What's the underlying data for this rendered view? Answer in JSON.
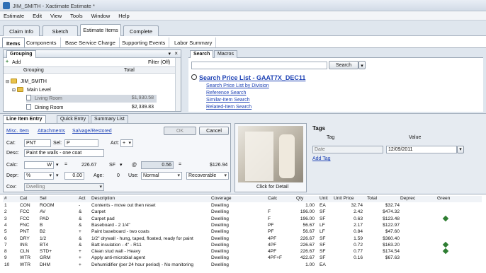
{
  "window": {
    "title": "JIM_SMITH - Xactimate Estimate *"
  },
  "menu": [
    "Estimate",
    "Edit",
    "View",
    "Tools",
    "Window",
    "Help"
  ],
  "main_tabs": [
    "Claim Info",
    "Sketch",
    "Estimate Items",
    "Complete"
  ],
  "sub_tabs": [
    "Items",
    "Components",
    "Base Service Charge",
    "Supporting Events",
    "Labor Summary"
  ],
  "grouping": {
    "title": "Grouping",
    "add_label": "Add",
    "filter_label": "Filter (Off)",
    "col_grouping": "Grouping",
    "col_total": "Total",
    "tree": [
      {
        "label": "JIM_SMITH",
        "total": ""
      },
      {
        "label": "Main Level",
        "total": ""
      },
      {
        "label": "Living Room",
        "total": "$1,930.58"
      },
      {
        "label": "Dining Room",
        "total": "$2,339.83"
      }
    ]
  },
  "search": {
    "tabs": [
      "Search",
      "Macros"
    ],
    "button": "Search",
    "input_value": "",
    "title": "Search Price List - GAAT7X_DEC11",
    "links": [
      "Search Price List by Division",
      "Reference Search",
      "Similar-Item Search",
      "Related-Item Search"
    ]
  },
  "entry": {
    "tabs": [
      "Line Item Entry",
      "Quick Entry",
      "Summary List"
    ],
    "links": [
      "Misc. Item",
      "Attachments",
      "Salvage/Restored"
    ],
    "ok": "OK",
    "cancel": "Cancel",
    "cat_label": "Cat:",
    "cat_value": "PNT",
    "sel_label": "Sel:",
    "sel_value": "P",
    "act_label": "Act:",
    "act_value": "+",
    "desc_label": "Desc:",
    "desc_value": "Paint the walls - one coat",
    "calc_label": "Calc:",
    "calc_value": "W",
    "qty_value": "226.67",
    "unit_value": "SF",
    "at_symbol": "@",
    "price_value": "0.56",
    "total_value": "$126.94",
    "depr_label": "Depr:",
    "depr_value": "%",
    "depr_amount": "0.00",
    "age_label": "Age:",
    "age_value": "0",
    "use_label": "Use:",
    "use_value": "Normal",
    "recover_value": "Recoverable",
    "cov_label": "Cov:",
    "cov_value": "Dwelling",
    "photo_caption": "Click for Detail"
  },
  "tags": {
    "title": "Tags",
    "col_tag": "Tag",
    "col_value": "Value",
    "tag_value": "Date",
    "date_value": "12/09/2011",
    "add_tag": "Add Tag"
  },
  "table": {
    "headers": [
      "#",
      "Cat",
      "Sel",
      "Act",
      "Description",
      "Coverage",
      "Calc",
      "Qty",
      "Unit",
      "Unit Price",
      "Total",
      "Deprec",
      "Green"
    ],
    "rows": [
      [
        "1",
        "CON",
        "ROOM",
        "-",
        "Contents - move out then reset",
        "Dwelling",
        "",
        "1.00",
        "EA",
        "32.74",
        "$32.74",
        "",
        ""
      ],
      [
        "2",
        "FCC",
        "AV",
        "&",
        "Carpet",
        "Dwelling",
        "F",
        "196.00",
        "SF",
        "2.42",
        "$474.32",
        "",
        ""
      ],
      [
        "3",
        "FCC",
        "PAD",
        "&",
        "Carpet pad",
        "Dwelling",
        "F",
        "196.00",
        "SF",
        "0.63",
        "$123.48",
        "",
        "yes"
      ],
      [
        "4",
        "FNC",
        "B",
        "&",
        "Baseboard - 2 1/4\"",
        "Dwelling",
        "PF",
        "56.67",
        "LF",
        "2.17",
        "$122.97",
        "",
        ""
      ],
      [
        "5",
        "PNT",
        "B2",
        "+",
        "Paint baseboard - two coats",
        "Dwelling",
        "PF",
        "56.67",
        "LF",
        "0.84",
        "$47.60",
        "",
        ""
      ],
      [
        "6",
        "DRY",
        "1/2",
        "&",
        "1/2\" drywall - hung, taped, floated, ready for paint",
        "Dwelling",
        "4PF",
        "226.67",
        "SF",
        "1.59",
        "$360.40",
        "",
        ""
      ],
      [
        "7",
        "INS",
        "BT4",
        "&",
        "Batt insulation - 4\" - R11",
        "Dwelling",
        "4PF",
        "226.67",
        "SF",
        "0.72",
        "$163.20",
        "",
        "yes"
      ],
      [
        "8",
        "CLN",
        "STD+",
        "+",
        "Clean stud wall - Heavy",
        "Dwelling",
        "4PF",
        "226.67",
        "SF",
        "0.77",
        "$174.54",
        "",
        "yes"
      ],
      [
        "9",
        "WTR",
        "GRM",
        "+",
        "Apply anti-microbial agent",
        "Dwelling",
        "4PF+F",
        "422.67",
        "SF",
        "0.16",
        "$67.63",
        "",
        ""
      ],
      [
        "10",
        "WTR",
        "DHM",
        "+",
        "Dehumidifier (per 24 hour period) - No monitoring",
        "Dwelling",
        "",
        "1.00",
        "EA",
        "",
        "",
        "",
        ""
      ]
    ]
  }
}
